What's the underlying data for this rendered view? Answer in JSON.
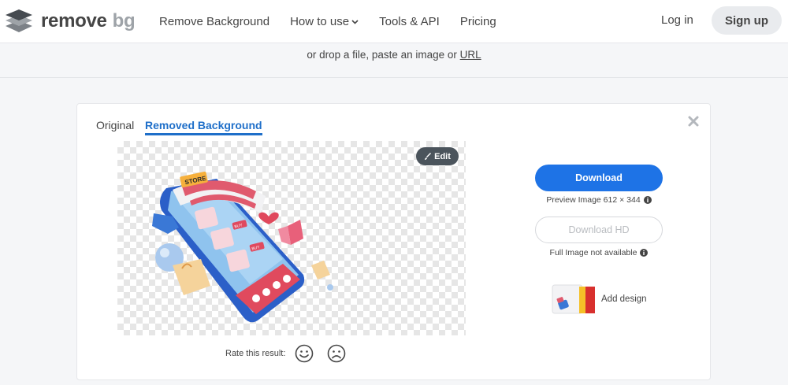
{
  "brand": {
    "word1": "remove",
    "word2": "bg"
  },
  "nav": {
    "items": [
      {
        "label": "Remove Background"
      },
      {
        "label": "How to use"
      },
      {
        "label": "Tools & API"
      },
      {
        "label": "Pricing"
      }
    ],
    "login": "Log in",
    "signup": "Sign up"
  },
  "upload": {
    "prefix": "or drop a file, paste an image or ",
    "url_link": "URL"
  },
  "result": {
    "tabs": {
      "original": "Original",
      "removed": "Removed Background"
    },
    "edit_label": "Edit",
    "illustration_text": {
      "store_sign": "STORE",
      "buy_tag_1": "BUY",
      "buy_tag_2": "BUY"
    },
    "rate_label": "Rate this result:",
    "download_label": "Download",
    "preview_info": "Preview Image 612 × 344",
    "download_hd_label": "Download HD",
    "full_info": "Full Image not available",
    "add_design_label": "Add design"
  },
  "colors": {
    "primary": "#1e73e6",
    "tab_active": "#1f6fc9",
    "text": "#454545",
    "logo_secondary": "#9ea3a8",
    "edit_bg": "#4b545c"
  },
  "icons": {
    "logo": "layered-diamond-logo-icon",
    "chevron": "chevron-down-icon",
    "close": "close-icon",
    "edit": "brush-icon",
    "happy": "happy-face-icon",
    "sad": "sad-face-icon",
    "info": "info-icon"
  }
}
